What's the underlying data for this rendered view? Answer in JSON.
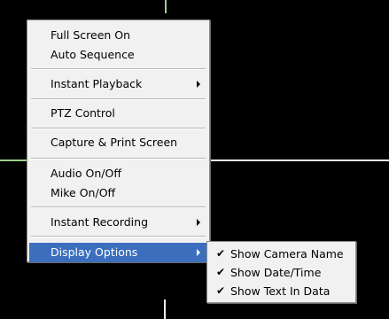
{
  "context_menu": {
    "items": [
      {
        "label": "Full Screen On"
      },
      {
        "label": "Auto Sequence"
      },
      {
        "label": "Instant Playback"
      },
      {
        "label": "PTZ Control"
      },
      {
        "label": "Capture & Print Screen"
      },
      {
        "label": "Audio On/Off"
      },
      {
        "label": "Mike On/Off"
      },
      {
        "label": "Instant Recording"
      },
      {
        "label": "Display Options"
      }
    ],
    "selected_item": "Display Options"
  },
  "display_options_submenu": {
    "items": [
      {
        "label": "Show Camera Name",
        "checked": true
      },
      {
        "label": "Show Date/Time",
        "checked": true
      },
      {
        "label": "Show Text In Data",
        "checked": true
      }
    ],
    "check_glyph": "✔"
  },
  "colors": {
    "background": "#000000",
    "menu_background": "#f1f1f1",
    "selection": "#3b6fbe",
    "grid_line_active": "#9ecf8a",
    "grid_line": "#f0f0f0"
  },
  "icons": {
    "submenu_arrow": "chevron-right-icon",
    "check": "check-icon"
  }
}
